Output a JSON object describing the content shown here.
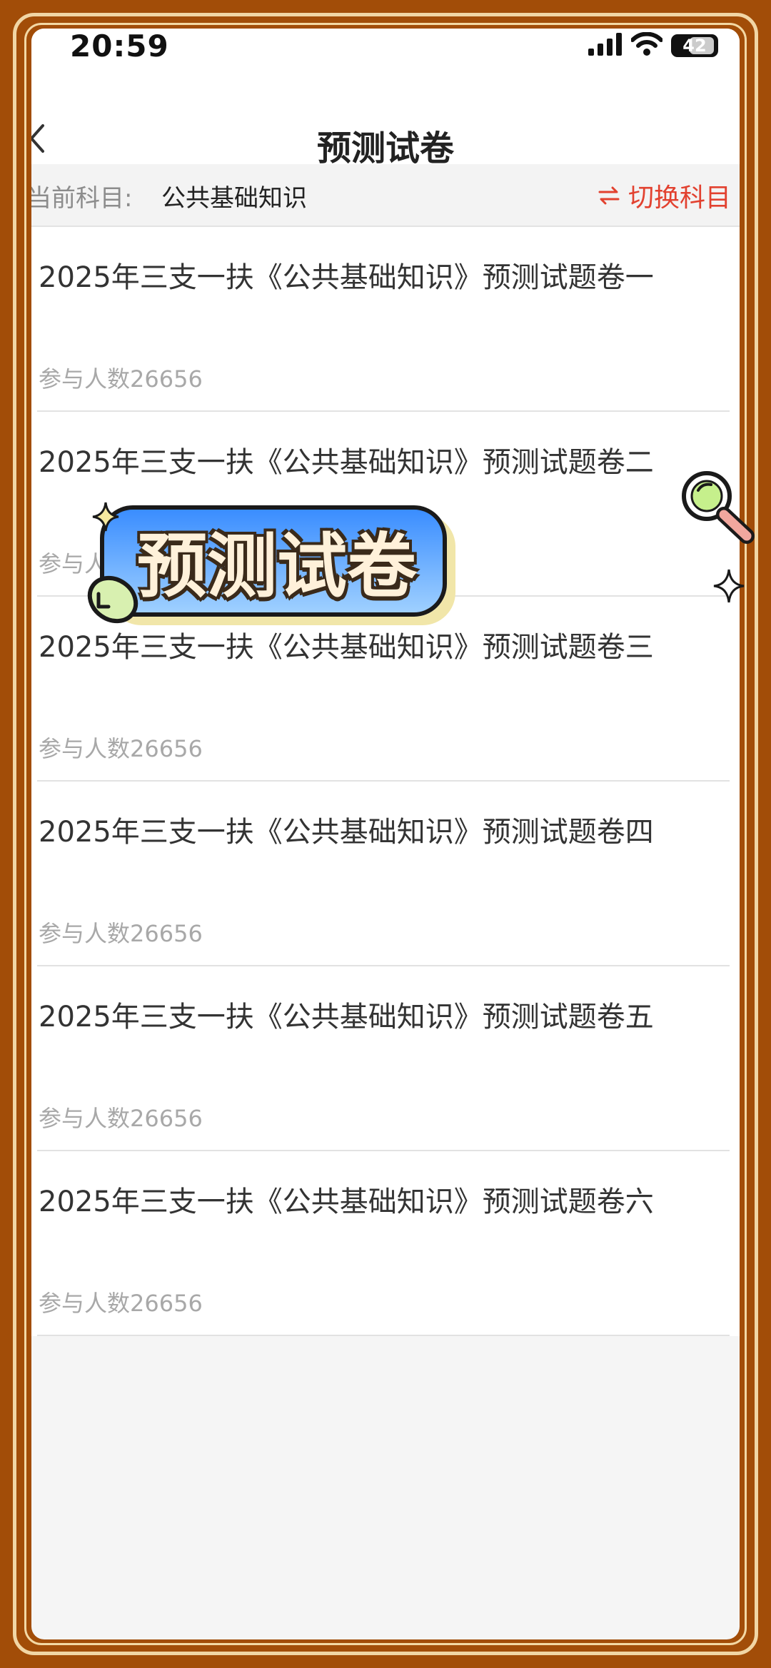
{
  "status_bar": {
    "time": "20:59",
    "battery": "42"
  },
  "nav": {
    "title": "预测试卷"
  },
  "subject": {
    "label": "当前科目:",
    "value": "公共基础知识",
    "switch_label": "切换科目"
  },
  "papers": [
    {
      "title": "2025年三支一扶《公共基础知识》预测试题卷一",
      "participants": "参与人数26656"
    },
    {
      "title": "2025年三支一扶《公共基础知识》预测试题卷二",
      "participants": "参与人数26656"
    },
    {
      "title": "2025年三支一扶《公共基础知识》预测试题卷三",
      "participants": "参与人数26656"
    },
    {
      "title": "2025年三支一扶《公共基础知识》预测试题卷四",
      "participants": "参与人数26656"
    },
    {
      "title": "2025年三支一扶《公共基础知识》预测试题卷五",
      "participants": "参与人数26656"
    },
    {
      "title": "2025年三支一扶《公共基础知识》预测试题卷六",
      "participants": "参与人数26656"
    }
  ],
  "overlay": {
    "sticker_text": "预测试卷"
  }
}
